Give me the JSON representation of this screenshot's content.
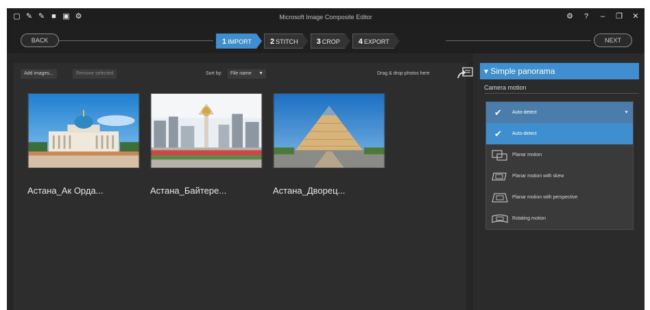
{
  "window": {
    "title": "Microsoft Image Composite Editor",
    "quick_icons": [
      "new-icon",
      "open-icon",
      "open-folder-icon",
      "save-icon",
      "camera-icon",
      "settings-icon"
    ],
    "controls": [
      "settings-icon",
      "help-icon",
      "minimize-icon",
      "restore-icon",
      "close-icon"
    ]
  },
  "nav": {
    "back": "BACK",
    "next": "NEXT",
    "steps": [
      {
        "num": "1",
        "label": "IMPORT",
        "active": true
      },
      {
        "num": "2",
        "label": "STITCH",
        "active": false
      },
      {
        "num": "3",
        "label": "CROP",
        "active": false
      },
      {
        "num": "4",
        "label": "EXPORT",
        "active": false
      }
    ]
  },
  "toolbar": {
    "add_images": "Add images...",
    "remove_selected": "Remove selected",
    "sort_label": "Sort by:",
    "sort_value": "File name",
    "drop_hint": "Drag & drop photos here"
  },
  "images": [
    {
      "caption": "Астана_Ак Орда..."
    },
    {
      "caption": "Астана_Байтере..."
    },
    {
      "caption": "Астана_Дворец..."
    }
  ],
  "panel": {
    "header": "Simple panorama",
    "camera_motion_label": "Camera motion",
    "options": [
      {
        "label": "Auto-detect",
        "state": "selected"
      },
      {
        "label": "Auto-detect",
        "state": "highlighted"
      },
      {
        "label": "Planar motion",
        "state": "normal"
      },
      {
        "label": "Planar motion with skew",
        "state": "normal"
      },
      {
        "label": "Planar motion with perspective",
        "state": "normal"
      },
      {
        "label": "Rotating motion",
        "state": "normal"
      }
    ]
  },
  "colors": {
    "accent": "#3f8fd0",
    "background": "#262626",
    "panel": "#2d2d2d"
  }
}
